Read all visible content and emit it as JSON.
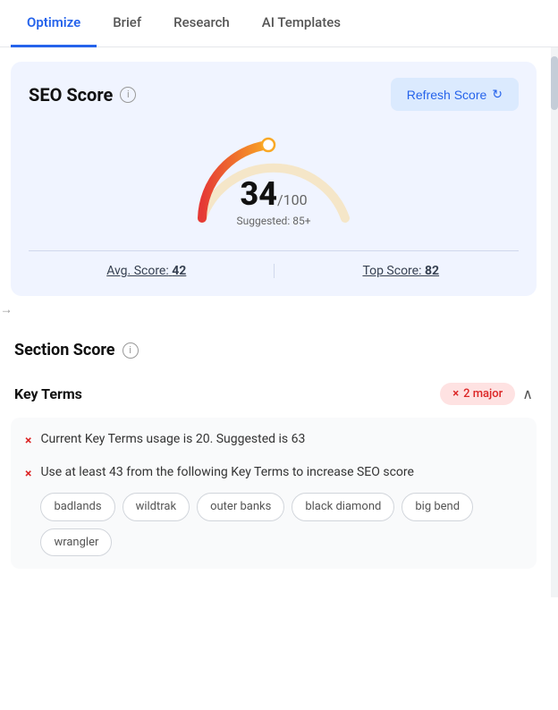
{
  "tabs": [
    {
      "id": "optimize",
      "label": "Optimize",
      "active": true
    },
    {
      "id": "brief",
      "label": "Brief",
      "active": false
    },
    {
      "id": "research",
      "label": "Research",
      "active": false
    },
    {
      "id": "ai-templates",
      "label": "AI Templates",
      "active": false
    }
  ],
  "seo_score": {
    "title": "SEO Score",
    "info_icon": "i",
    "refresh_button": "Refresh Score",
    "score": "34",
    "out_of": "/100",
    "suggested_label": "Suggested: 85+",
    "avg_label": "Avg. Score:",
    "avg_value": "42",
    "top_label": "Top Score:",
    "top_value": "82"
  },
  "section_score": {
    "title": "Section Score"
  },
  "key_terms": {
    "title": "Key Terms",
    "badge_text": "2 major",
    "issues": [
      {
        "text": "Current Key Terms usage is 20. Suggested is 63"
      },
      {
        "text": "Use at least 43 from the following Key Terms to increase SEO score"
      }
    ],
    "tags": [
      "badlands",
      "wildtrak",
      "outer banks",
      "black diamond",
      "big bend",
      "wrangler"
    ]
  }
}
